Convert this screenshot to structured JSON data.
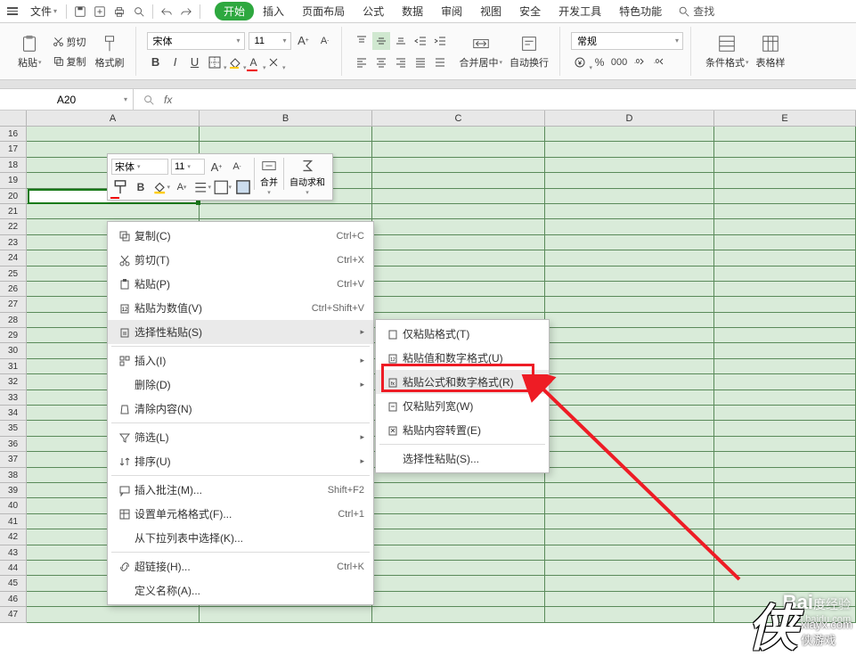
{
  "menubar": {
    "file": "文件",
    "search": "查找"
  },
  "tabs": [
    "开始",
    "插入",
    "页面布局",
    "公式",
    "数据",
    "审阅",
    "视图",
    "安全",
    "开发工具",
    "特色功能"
  ],
  "ribbon": {
    "paste": "粘贴",
    "cut": "剪切",
    "copy": "复制",
    "format_painter": "格式刷",
    "font_name": "宋体",
    "font_size": "11",
    "merge_center": "合并居中",
    "wrap_text": "自动换行",
    "number_format": "常规",
    "cond_format": "条件格式",
    "table_style": "表格样"
  },
  "namebox": "A20",
  "fx": "fx",
  "columns": [
    "A",
    "B",
    "C",
    "D",
    "E"
  ],
  "rows": [
    "16",
    "17",
    "18",
    "19",
    "20",
    "21",
    "22",
    "23",
    "24",
    "25",
    "26",
    "27",
    "28",
    "29",
    "30",
    "31",
    "32",
    "33",
    "34",
    "35",
    "36",
    "37",
    "38",
    "39",
    "40",
    "41",
    "42",
    "43",
    "44",
    "45",
    "46",
    "47"
  ],
  "mini": {
    "font_name": "宋体",
    "font_size": "11",
    "merge": "合并",
    "autosum": "自动求和"
  },
  "ctx": {
    "copy": {
      "label": "复制(C)",
      "shortcut": "Ctrl+C"
    },
    "cut": {
      "label": "剪切(T)",
      "shortcut": "Ctrl+X"
    },
    "paste": {
      "label": "粘贴(P)",
      "shortcut": "Ctrl+V"
    },
    "paste_values": {
      "label": "粘贴为数值(V)",
      "shortcut": "Ctrl+Shift+V"
    },
    "paste_special": {
      "label": "选择性粘贴(S)"
    },
    "insert": {
      "label": "插入(I)"
    },
    "delete": {
      "label": "删除(D)"
    },
    "clear": {
      "label": "清除内容(N)"
    },
    "filter": {
      "label": "筛选(L)"
    },
    "sort": {
      "label": "排序(U)"
    },
    "insert_comment": {
      "label": "插入批注(M)...",
      "shortcut": "Shift+F2"
    },
    "format_cells": {
      "label": "设置单元格格式(F)...",
      "shortcut": "Ctrl+1"
    },
    "dropdown_list": {
      "label": "从下拉列表中选择(K)..."
    },
    "hyperlink": {
      "label": "超链接(H)...",
      "shortcut": "Ctrl+K"
    },
    "define_name": {
      "label": "定义名称(A)..."
    }
  },
  "submenu": {
    "paste_format": "仅粘贴格式(T)",
    "paste_value_num": "粘贴值和数字格式(U)",
    "paste_formula_num": "粘贴公式和数字格式(R)",
    "paste_colwidth": "仅粘贴列宽(W)",
    "paste_transpose": "粘贴内容转置(E)",
    "paste_special_dlg": "选择性粘贴(S)..."
  },
  "watermark": {
    "baidu": "Bai",
    "jingyan": "经验",
    "url1": "jingyan.baidu.com",
    "char": "侠",
    "url2": "xiayx.com",
    "url3": "侠游戏"
  }
}
